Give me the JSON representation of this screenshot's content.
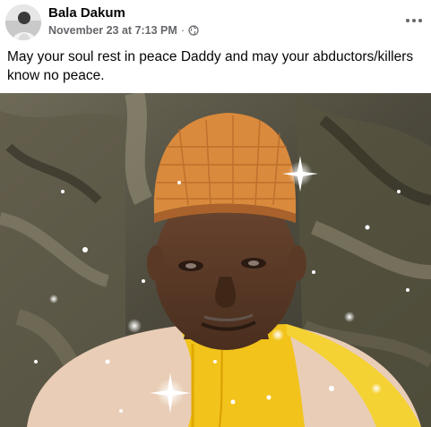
{
  "post": {
    "author": "Bala Dakum",
    "timestamp": "November 23 at 7:13 PM",
    "separator": "·",
    "audience_icon": "globe-icon",
    "more_icon": "more-options-icon",
    "text": "May your soul rest in peace Daddy and may your abductors/killers know no peace."
  },
  "colors": {
    "meta_gray": "#65676b",
    "text": "#050505",
    "cap_orange": "#d98a3c",
    "robe_yellow": "#f2c31a",
    "robe_cream": "#e9cdb6",
    "skin": "#5a3a26"
  }
}
